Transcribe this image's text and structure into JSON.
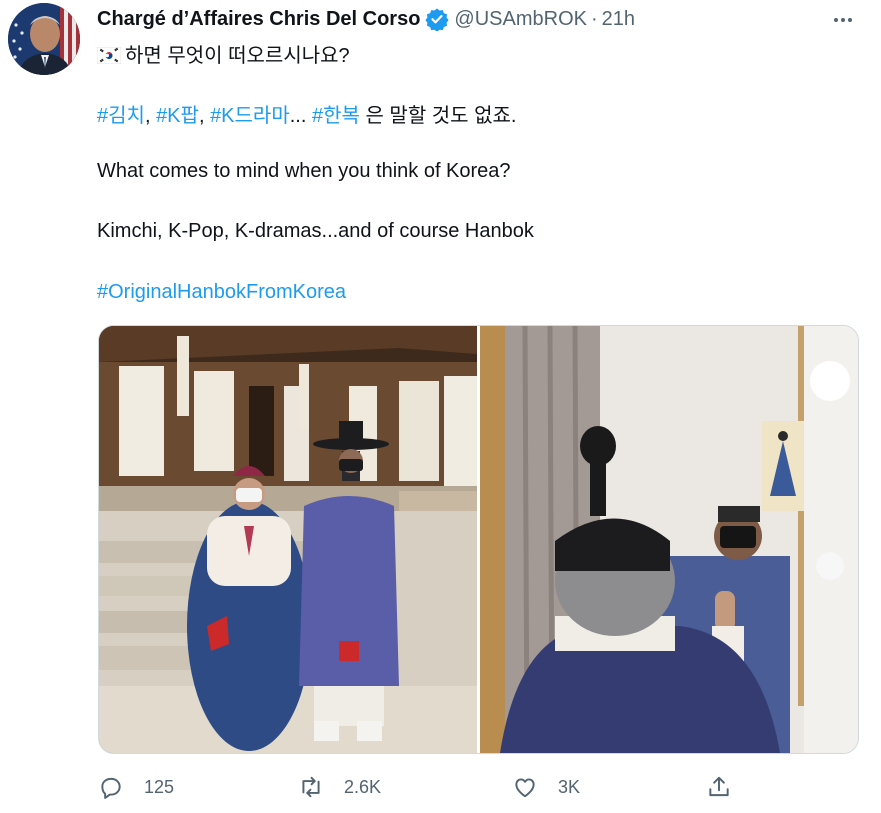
{
  "tweet": {
    "author_name": "Chargé d’Affaires Chris Del Corso",
    "handle": "@USAmbROK",
    "separator": "·",
    "time": "21h",
    "lines": {
      "l1": "하면 무엇이 떠오르시나요?",
      "h1": "#김치",
      "s1": ", ",
      "h2": "#K팝",
      "s2": ", ",
      "h3": "#K드라마",
      "s3": "... ",
      "h4": "#한복",
      "s4": " 은 말할 것도 없죠.",
      "l3": "What comes to mind when you think of Korea?",
      "l4": "Kimchi, K-Pop, K-dramas...and of course Hanbok",
      "l5": "#OriginalHanbokFromKorea"
    }
  },
  "actions": {
    "reply_count": "125",
    "retweet_count": "2.6K",
    "like_count": "3K"
  },
  "colors": {
    "accent": "#1d9bf0",
    "secondary_text": "#536471",
    "verified": "#1d9bf0"
  },
  "icons": [
    "flag-korea-icon",
    "verified-badge-icon",
    "more-options-icon",
    "reply-icon",
    "retweet-icon",
    "like-icon",
    "share-icon"
  ]
}
